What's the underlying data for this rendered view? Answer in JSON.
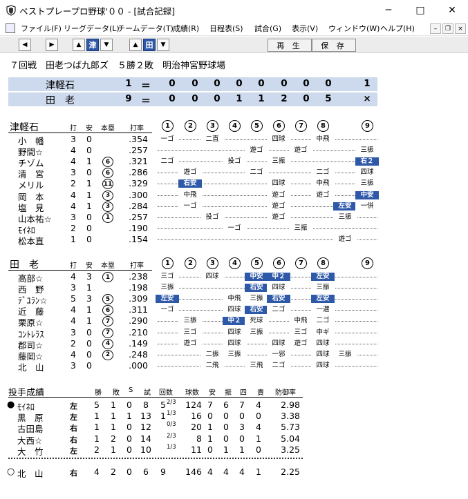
{
  "window": {
    "title": "ベストプレープロ野球'００ - [試合記録]",
    "minimize": "─",
    "maximize": "□",
    "close": "✕"
  },
  "menus": [
    "ファイル(F)",
    "リーグデータ(L)",
    "チームデータ(T)",
    "成績(R)",
    "日程表(S)",
    "試合(G)",
    "表示(V)",
    "ウィンドウ(W)",
    "ヘルプ(H)"
  ],
  "toolbar": {
    "team_away": "津",
    "team_home": "田",
    "play": "再 生",
    "save": "保 存"
  },
  "game": {
    "info": "７回戦　田老つば九郎ズ　５勝２敗　明治神宮野球場"
  },
  "scoreboard": {
    "rows": [
      {
        "team": "津軽石",
        "runs": "1",
        "eq": "＝",
        "innings": [
          "0",
          "0",
          "0",
          "0",
          "0",
          "0",
          "0",
          "0"
        ],
        "last": "1"
      },
      {
        "team": "田　老",
        "runs": "9",
        "eq": "＝",
        "innings": [
          "0",
          "0",
          "0",
          "1",
          "1",
          "2",
          "0",
          "5"
        ],
        "last": "×"
      }
    ]
  },
  "headers": {
    "ab": "打",
    "h": "安",
    "hr": "本塁",
    "avg": "打率",
    "inn": [
      "1",
      "2",
      "3",
      "4",
      "5",
      "6",
      "7",
      "8",
      "9"
    ]
  },
  "away": {
    "team": "津軽石",
    "players": [
      {
        "name": "小　幡",
        "ab": "3",
        "h": "0",
        "hr": "",
        "avg": ".354"
      },
      {
        "name": "野間☆",
        "ab": "4",
        "h": "0",
        "hr": "",
        "avg": ".257"
      },
      {
        "name": "チゾム",
        "ab": "4",
        "h": "1",
        "hr": "6",
        "avg": ".321"
      },
      {
        "name": "清　宮",
        "ab": "3",
        "h": "0",
        "hr": "6",
        "avg": ".286"
      },
      {
        "name": "メリル",
        "ab": "2",
        "h": "1",
        "hr": "11",
        "avg": ".329"
      },
      {
        "name": "岡　本",
        "ab": "4",
        "h": "1",
        "hr": "3",
        "avg": ".300"
      },
      {
        "name": "塩　見",
        "ab": "4",
        "h": "1",
        "hr": "3",
        "avg": ".284"
      },
      {
        "name": "山本祐☆",
        "ab": "3",
        "h": "0",
        "hr": "1",
        "avg": ".257"
      },
      {
        "name": "ﾓｲﾈﾛ",
        "ab": "2",
        "h": "0",
        "hr": "",
        "avg": ".190"
      },
      {
        "name": "松本直",
        "ab": "1",
        "h": "0",
        "hr": "",
        "avg": ".154"
      }
    ],
    "results": [
      [
        "一ゴ",
        "",
        "二直",
        "",
        "",
        "四球",
        "",
        "中飛",
        "",
        ""
      ],
      [
        "",
        "",
        "",
        "",
        "遊ゴ",
        "",
        "遊ゴ",
        "",
        "",
        "三振"
      ],
      [
        "二ゴ",
        "",
        "",
        "投ゴ",
        "",
        "三振",
        "",
        "",
        "",
        "右２"
      ],
      [
        "",
        "遊ゴ",
        "",
        "",
        "二ゴ",
        "",
        "",
        "二ゴ",
        "",
        "四球"
      ],
      [
        "",
        "右安",
        "",
        "",
        "",
        "四球",
        "",
        "中飛",
        "",
        "三振"
      ],
      [
        "",
        "中飛",
        "",
        "",
        "",
        "遊ゴ",
        "",
        "遊ゴ",
        "",
        "中安"
      ],
      [
        "",
        "一ゴ",
        "",
        "",
        "",
        "遊ゴ",
        "",
        "",
        "左安",
        "一併"
      ],
      [
        "",
        "",
        "投ゴ",
        "",
        "",
        "遊ゴ",
        "",
        "",
        "三振",
        ""
      ],
      [
        "",
        "",
        "",
        "一ゴ",
        "",
        "",
        "三振",
        "",
        "",
        ""
      ],
      [
        "",
        "",
        "",
        "",
        "",
        "",
        "",
        "",
        "遊ゴ",
        ""
      ]
    ]
  },
  "home": {
    "team": "田　老",
    "players": [
      {
        "name": "高部☆",
        "ab": "4",
        "h": "3",
        "hr": "1",
        "avg": ".238"
      },
      {
        "name": "西　野",
        "ab": "3",
        "h": "1",
        "hr": "",
        "avg": ".198"
      },
      {
        "name": "ﾃﾞﾕﾗﾝ☆",
        "ab": "5",
        "h": "3",
        "hr": "5",
        "avg": ".309"
      },
      {
        "name": "近　藤",
        "ab": "4",
        "h": "1",
        "hr": "6",
        "avg": ".311"
      },
      {
        "name": "栗原☆",
        "ab": "4",
        "h": "1",
        "hr": "7",
        "avg": ".290"
      },
      {
        "name": "ｺﾝﾄﾚﾗｽ",
        "ab": "3",
        "h": "0",
        "hr": "7",
        "avg": ".210"
      },
      {
        "name": "郡司☆",
        "ab": "2",
        "h": "0",
        "hr": "4",
        "avg": ".149"
      },
      {
        "name": "藤岡☆",
        "ab": "4",
        "h": "0",
        "hr": "2",
        "avg": ".248"
      },
      {
        "name": "北　山",
        "ab": "3",
        "h": "0",
        "hr": "",
        "avg": ".000"
      }
    ],
    "results": [
      [
        "三ゴ",
        "",
        "四球",
        "",
        "中安",
        "中２",
        "",
        "左安",
        ""
      ],
      [
        "三振",
        "",
        "",
        "",
        "右安",
        "四球",
        "",
        "三振",
        ""
      ],
      [
        "左安",
        "",
        "",
        "中飛",
        "三振",
        "右安",
        "",
        "左安",
        ""
      ],
      [
        "一ゴ",
        "",
        "",
        "四球",
        "右安",
        "二ゴ",
        "",
        "一選",
        ""
      ],
      [
        "",
        "三振",
        "",
        "中２",
        "死球",
        "",
        "中飛",
        "二ゴ",
        ""
      ],
      [
        "",
        "三ゴ",
        "",
        "四球",
        "三振",
        "",
        "三ゴ",
        "中ギ",
        ""
      ],
      [
        "",
        "遊ゴ",
        "",
        "四球",
        "",
        "四球",
        "遊ゴ",
        "四球",
        ""
      ],
      [
        "",
        "",
        "二振",
        "三振",
        "",
        "一邪",
        "",
        "四球",
        "三振"
      ],
      [
        "",
        "",
        "二飛",
        "",
        "三飛",
        "二ゴ",
        "",
        "四球",
        ""
      ]
    ]
  },
  "pitching": {
    "title": "投手成績",
    "headers": [
      "勝",
      "敗",
      "S",
      "試",
      "回数",
      "球数",
      "安",
      "振",
      "四",
      "責",
      "防御率"
    ],
    "away": [
      {
        "mark": "●",
        "name": "ﾓｲﾈﾛ",
        "hand": "左",
        "w": "5",
        "l": "1",
        "s": "0",
        "g": "8",
        "ip_int": "5",
        "ip_frac": "2/3",
        "pitches": "124",
        "h": "7",
        "k": "6",
        "bb": "7",
        "er": "4",
        "era": "2.98"
      },
      {
        "mark": "",
        "name": "黒　原",
        "hand": "左",
        "w": "1",
        "l": "1",
        "s": "1",
        "g": "13",
        "ip_int": "1",
        "ip_frac": "1/3",
        "pitches": "16",
        "h": "0",
        "k": "0",
        "bb": "0",
        "er": "0",
        "era": "3.38"
      },
      {
        "mark": "",
        "name": "古田島",
        "hand": "右",
        "w": "1",
        "l": "1",
        "s": "0",
        "g": "12",
        "ip_int": "",
        "ip_frac": "0/3",
        "pitches": "20",
        "h": "1",
        "k": "0",
        "bb": "3",
        "er": "4",
        "era": "5.73"
      },
      {
        "mark": "",
        "name": "大西☆",
        "hand": "右",
        "w": "1",
        "l": "2",
        "s": "0",
        "g": "14",
        "ip_int": "",
        "ip_frac": "2/3",
        "pitches": "8",
        "h": "1",
        "k": "0",
        "bb": "0",
        "er": "1",
        "era": "5.04"
      },
      {
        "mark": "",
        "name": "大　竹",
        "hand": "左",
        "w": "2",
        "l": "1",
        "s": "0",
        "g": "10",
        "ip_int": "",
        "ip_frac": "1/3",
        "pitches": "11",
        "h": "0",
        "k": "1",
        "bb": "1",
        "er": "0",
        "era": "3.25"
      }
    ],
    "home": [
      {
        "mark": "○",
        "name": "北　山",
        "hand": "右",
        "w": "4",
        "l": "2",
        "s": "0",
        "g": "6",
        "ip_int": "9",
        "ip_frac": "",
        "pitches": "146",
        "h": "4",
        "k": "4",
        "bb": "4",
        "er": "1",
        "era": "2.25"
      }
    ]
  }
}
